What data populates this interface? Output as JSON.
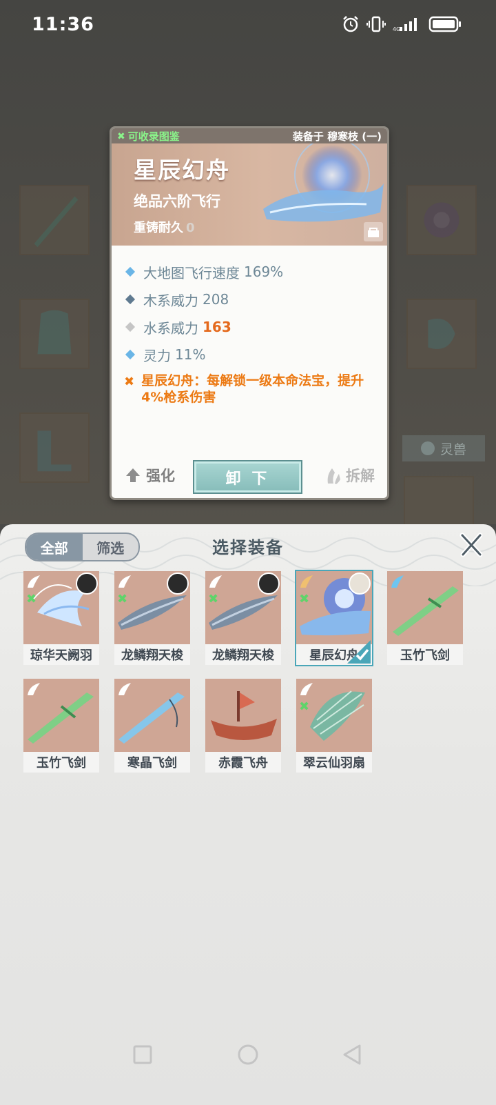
{
  "status_bar": {
    "time": "11:36"
  },
  "detail": {
    "collect_label": "可收录图鉴",
    "equipped_label": "装备于 穆寒枝 (一)",
    "title": "星辰幻舟",
    "grade": "绝品六阶飞行",
    "durability_label": "重铸耐久",
    "durability_value": "0",
    "stats": [
      {
        "label": "大地图飞行速度",
        "value": "169%",
        "diamond_color": "#6ab5e6"
      },
      {
        "label": "木系威力",
        "value": "208",
        "diamond_color": "#5f7a90"
      },
      {
        "label": "水系威力",
        "value": "163",
        "diamond_color": "#c5c5c5"
      },
      {
        "label": "灵力",
        "value": "11%",
        "diamond_color": "#6ab5e6"
      }
    ],
    "effect_text": "星辰幻舟：每解锁一级本命法宝，提升4%枪系伤害",
    "strengthen_label": "强化",
    "unequip_label": "卸 下",
    "disassemble_label": "拆解"
  },
  "background": {
    "beast_label": "灵兽"
  },
  "sheet": {
    "tab_all": "全部",
    "tab_filter": "筛选",
    "title": "选择装备",
    "items": [
      {
        "name": "琼华天阙羽",
        "collectable": true,
        "avatar": true,
        "locked": false,
        "selected": false,
        "art": "phoenix"
      },
      {
        "name": "龙鳞翔天梭",
        "collectable": true,
        "avatar": true,
        "locked": false,
        "selected": false,
        "art": "shuttle"
      },
      {
        "name": "龙鳞翔天梭",
        "collectable": true,
        "avatar": true,
        "locked": false,
        "selected": false,
        "art": "shuttle"
      },
      {
        "name": "星辰幻舟",
        "collectable": true,
        "avatar": true,
        "locked": false,
        "selected": true,
        "art": "boat-blue"
      },
      {
        "name": "玉竹飞剑",
        "collectable": false,
        "avatar": false,
        "locked": true,
        "selected": false,
        "art": "sword-green"
      },
      {
        "name": "玉竹飞剑",
        "collectable": false,
        "avatar": false,
        "locked": true,
        "selected": false,
        "art": "sword-green"
      },
      {
        "name": "寒晶飞剑",
        "collectable": false,
        "avatar": false,
        "locked": true,
        "selected": false,
        "art": "sword-blue"
      },
      {
        "name": "赤霞飞舟",
        "collectable": false,
        "avatar": false,
        "locked": true,
        "selected": false,
        "art": "boat-red"
      },
      {
        "name": "翠云仙羽扇",
        "collectable": true,
        "avatar": false,
        "locked": false,
        "selected": false,
        "art": "fan"
      }
    ]
  }
}
